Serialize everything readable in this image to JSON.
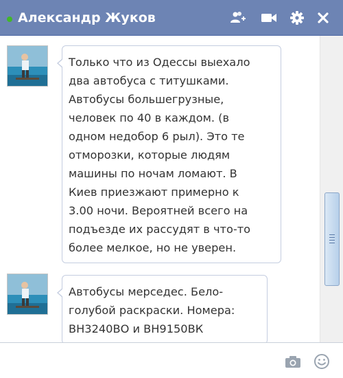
{
  "header": {
    "title": "Александр Жуков",
    "status": "online",
    "icons": [
      "add-friend-icon",
      "video-call-icon",
      "settings-gear-icon",
      "close-icon"
    ]
  },
  "messages": [
    {
      "text": "Только что из Одессы выехало\nдва автобуса с титушками.\nАвтобусы большегрузные,\nчеловек по 40 в каждом. (в\nодном недобор 6 рыл). Это те\nотморозки, которые людям\nмашины по ночам ломают. В\nКиев приезжают примерно к\n3.00 ночи. Вероятней всего на\nподъезде их рассудят в что-то\nболее мелкое, но не уверен."
    },
    {
      "text": "Автобусы мерседес. Бело-\nголубой раскраски. Номера:\nВН3240ВО и ВН9150ВК"
    }
  ],
  "composer": {
    "value": "",
    "icons": [
      "camera-icon",
      "emoji-icon"
    ]
  },
  "colors": {
    "header_bg": "#6d84b4",
    "online_dot": "#42b72a",
    "bubble_border": "#c4cde0"
  }
}
